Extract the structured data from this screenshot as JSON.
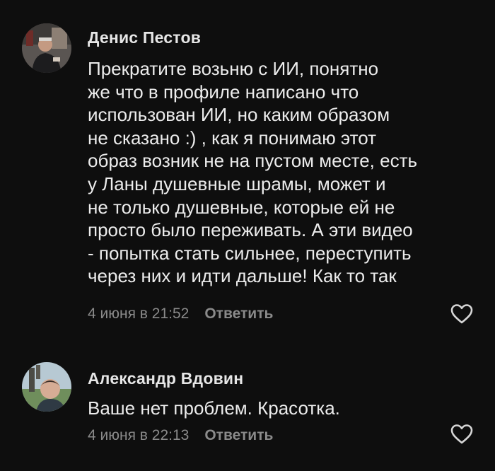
{
  "comments": [
    {
      "author": "Денис Пестов",
      "text": "Прекратите возьню с ИИ, понятно\nже что в профиле написано что\nиспользован ИИ, но каким образом\nне сказано :) , как я понимаю этот\nобраз возник не на пустом месте, есть\nу Ланы душевные шрамы, может и\nне только душевные, которые ей не\nпросто было переживать. А эти видео\n- попытка стать сильнее, переступить\nчерез них и идти дальше! Как то так",
      "date": "4 июня в 21:52",
      "reply_label": "Ответить",
      "avatar_icon": "user-photo"
    },
    {
      "author": "Александр Вдовин",
      "text": "Ваше нет проблем. Красотка.",
      "date": "4 июня в 22:13",
      "reply_label": "Ответить",
      "avatar_icon": "user-photo"
    }
  ],
  "colors": {
    "background": "#0e0e0e",
    "text": "#ececec",
    "meta": "#8a8a8a",
    "like_outline": "#d6d6d6"
  }
}
